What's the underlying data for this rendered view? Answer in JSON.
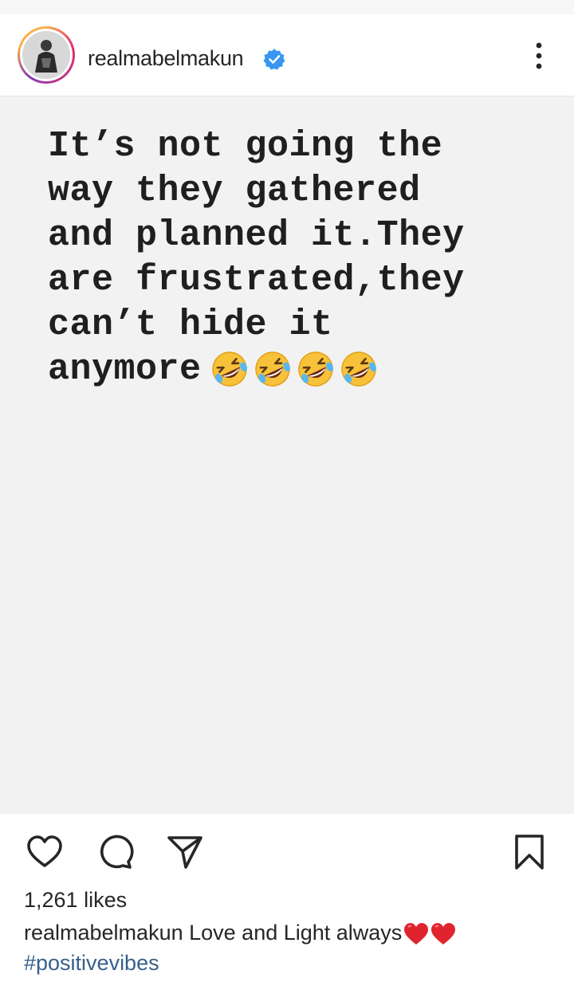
{
  "header": {
    "username": "realmabelmakun",
    "verified": true,
    "more_icon": "more-vertical-icon"
  },
  "post": {
    "text_lines": [
      "It’s not going the",
      "way they gathered",
      "and planned it.They",
      "are frustrated,they",
      "can’t hide it",
      "anymore"
    ],
    "emoji_count": 4,
    "emoji": "rolling-on-floor-laughing",
    "background": "#f2f2f2"
  },
  "actions": {
    "icons": [
      "heart-icon",
      "comment-icon",
      "share-icon",
      "bookmark-icon"
    ]
  },
  "likes": "1,261 likes",
  "caption": {
    "user": "realmabelmakun",
    "text": "Love and Light always",
    "emoji": [
      "red-heart",
      "red-heart"
    ],
    "hashtag": "#positivevibes"
  },
  "colors": {
    "verified": "#3897f0",
    "hashtag": "#385f8a",
    "heart": "#e0242e"
  }
}
